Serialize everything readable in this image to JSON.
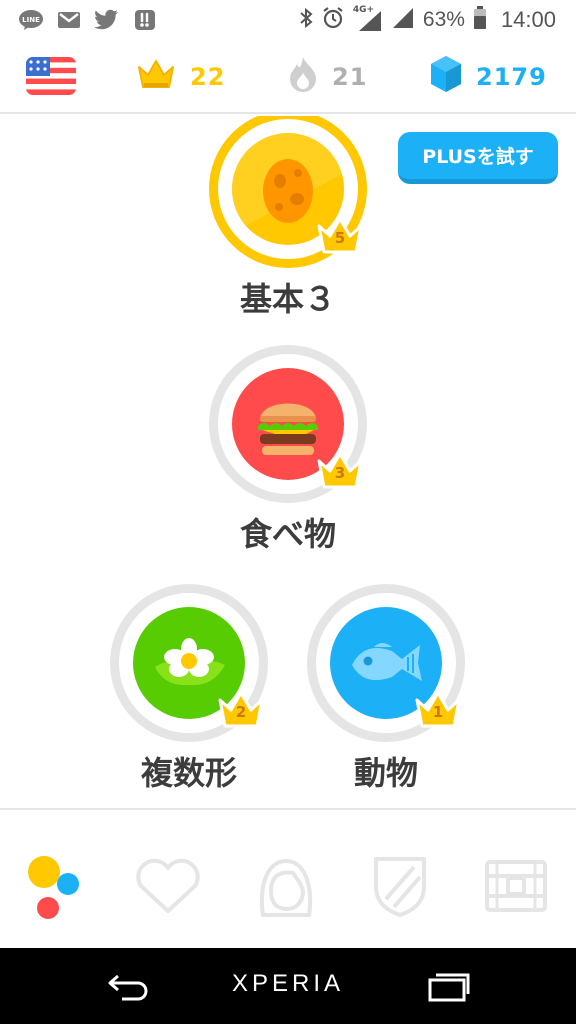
{
  "status_bar": {
    "battery_percent": "63%",
    "time": "14:00",
    "network_label": "4G+",
    "icons": [
      "line-icon",
      "gmail-icon",
      "twitter-icon",
      "app-notification-icon",
      "bluetooth-icon",
      "alarm-icon",
      "signal-icon",
      "signal-icon",
      "battery-icon"
    ]
  },
  "top_bar": {
    "language_flag": "us-flag-icon",
    "crowns": "22",
    "streak": "21",
    "gems": "2179"
  },
  "plus_button": {
    "label": "PLUSを試す"
  },
  "skills": [
    {
      "label": "基本３",
      "crown_level": "5",
      "icon": "egg-icon",
      "color": "#ffc800",
      "completed": true
    },
    {
      "label": "食べ物",
      "crown_level": "3",
      "icon": "burger-icon",
      "color": "#ff4b4b",
      "completed": false
    },
    {
      "label": "複数形",
      "crown_level": "2",
      "icon": "flower-icon",
      "color": "#58cc02",
      "completed": false
    },
    {
      "label": "動物",
      "crown_level": "1",
      "icon": "fish-icon",
      "color": "#1cb0f6",
      "completed": false
    }
  ],
  "tabs": [
    {
      "name": "learn",
      "icon": "learn-dots-icon",
      "active": true
    },
    {
      "name": "stories",
      "icon": "heart-icon",
      "active": false
    },
    {
      "name": "profile",
      "icon": "profile-avatar-icon",
      "active": false
    },
    {
      "name": "leaderboards",
      "icon": "shield-icon",
      "active": false
    },
    {
      "name": "shop",
      "icon": "treasure-chest-icon",
      "active": false
    }
  ],
  "nav_bar": {
    "brand": "XPERIA"
  },
  "colors": {
    "gold": "#ffc800",
    "blue": "#1cb0f6",
    "grey": "#afafaf",
    "red": "#ff4b4b",
    "green": "#58cc02",
    "text": "#3c3c3c"
  }
}
